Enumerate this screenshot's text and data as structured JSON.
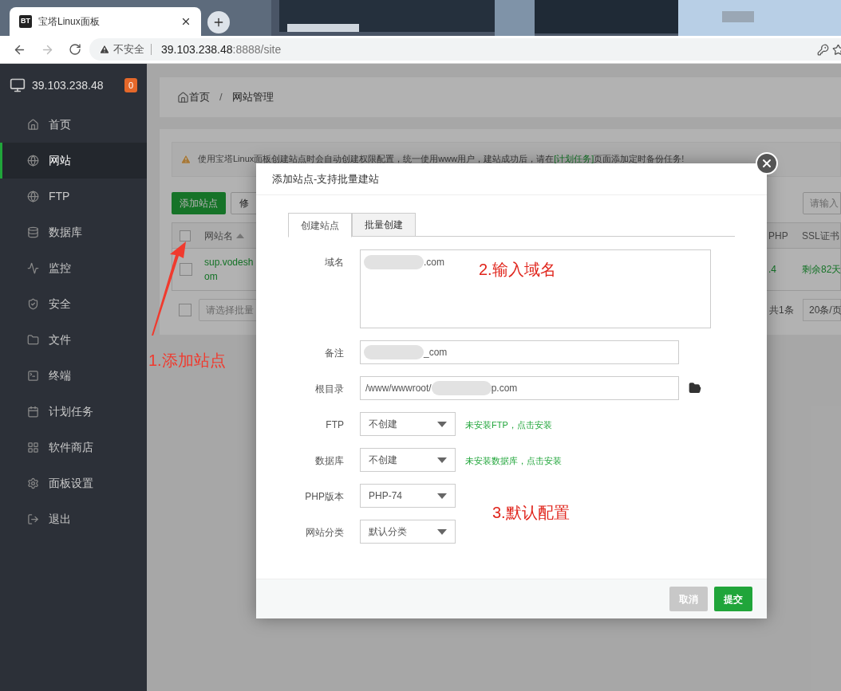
{
  "browser": {
    "tab_icon": "BT",
    "tab_title": "宝塔Linux面板",
    "security": "不安全",
    "url_host": "39.103.238.48",
    "url_rest": ":8888/site",
    "forward_disabled": true
  },
  "sidebar": {
    "host": "39.103.238.48",
    "badge": "0",
    "items": [
      {
        "label": "首页",
        "selected": false
      },
      {
        "label": "网站",
        "selected": true
      },
      {
        "label": "FTP",
        "selected": false
      },
      {
        "label": "数据库",
        "selected": false
      },
      {
        "label": "监控",
        "selected": false
      },
      {
        "label": "安全",
        "selected": false
      },
      {
        "label": "文件",
        "selected": false
      },
      {
        "label": "终端",
        "selected": false
      },
      {
        "label": "计划任务",
        "selected": false
      },
      {
        "label": "软件商店",
        "selected": false
      },
      {
        "label": "面板设置",
        "selected": false
      },
      {
        "label": "退出",
        "selected": false
      }
    ]
  },
  "breadcrumb": [
    "首页",
    "网站管理"
  ],
  "breadcrumb_separator": "/",
  "notice": {
    "before": "使用宝塔Linux面板创建站点时会自动创建权限配置，统一使用www用户，建站成功后，请在",
    "link": "[计划任务]",
    "after": "页面添加定时备份任务!"
  },
  "toolbar": {
    "buttons": [
      {
        "label": "添加站点",
        "kind": "primary"
      },
      {
        "label": "修",
        "kind": "default"
      }
    ],
    "search_placeholder": "请输入"
  },
  "table": {
    "select_all_checked": false,
    "columns": [
      "网站名",
      "PHP",
      "SSL证书"
    ],
    "rows": [
      {
        "name_line1": "sup.vodesh",
        "name_line2": "om",
        "php": ".4",
        "ssl": "剩余82天",
        "checked": false
      }
    ]
  },
  "table_footer": {
    "checked": false,
    "batch_placeholder": "请选择批量",
    "total": "共1条",
    "page_size": "20条/页"
  },
  "modal": {
    "title": "添加站点-支持批量建站",
    "tabs": [
      {
        "label": "创建站点",
        "selected": true
      },
      {
        "label": "批量创建",
        "selected": false
      }
    ],
    "fields": [
      {
        "kind": "textarea",
        "label": "域名",
        "value_after": ".com",
        "redacted": true
      },
      {
        "kind": "text",
        "label": "备注",
        "value_after": "_com",
        "redacted": true
      },
      {
        "kind": "path",
        "label": "根目录",
        "value_before": "/www/wwwroot/",
        "value_after": "p.com",
        "redacted": true
      },
      {
        "kind": "select",
        "label": "FTP",
        "value": "不创建",
        "hint": "未安装FTP，点击安装"
      },
      {
        "kind": "select",
        "label": "数据库",
        "value": "不创建",
        "hint": "未安装数据库，点击安装"
      },
      {
        "kind": "select",
        "label": "PHP版本",
        "value": "PHP-74"
      },
      {
        "kind": "select",
        "label": "网站分类",
        "value": "默认分类"
      }
    ],
    "buttons": [
      {
        "label": "取消",
        "kind": "cancel"
      },
      {
        "label": "提交",
        "kind": "submit"
      }
    ]
  },
  "annotations": [
    "1.添加站点",
    "2.输入域名",
    "3.默认配置"
  ]
}
